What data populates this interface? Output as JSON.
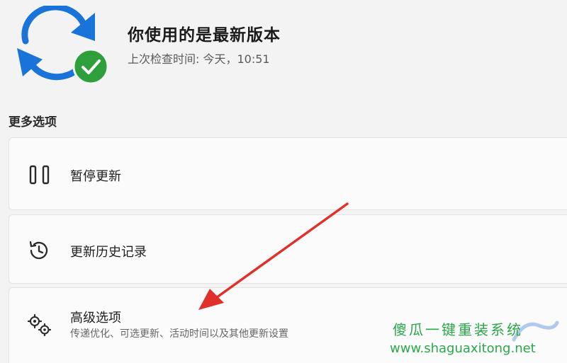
{
  "status": {
    "title": "你使用的是最新版本",
    "last_checked": "上次检查时间: 今天，10:51",
    "icon": "sync-check-icon"
  },
  "more_options": {
    "heading": "更多选项",
    "items": [
      {
        "label": "暂停更新",
        "icon": "pause-icon"
      },
      {
        "label": "更新历史记录",
        "icon": "history-icon"
      },
      {
        "label": "高级选项",
        "sub": "传递优化、可选更新、活动时间以及其他更新设置",
        "icon": "gears-icon"
      }
    ]
  },
  "annotation": {
    "arrow_color": "#e0302a"
  },
  "watermark": {
    "chinese": "傻瓜一键重装系统",
    "url": "www.shaguaxitong.net",
    "color": "#2aa84a"
  },
  "colors": {
    "accent_blue": "#1a73d9",
    "check_green": "#2e9f3a"
  }
}
